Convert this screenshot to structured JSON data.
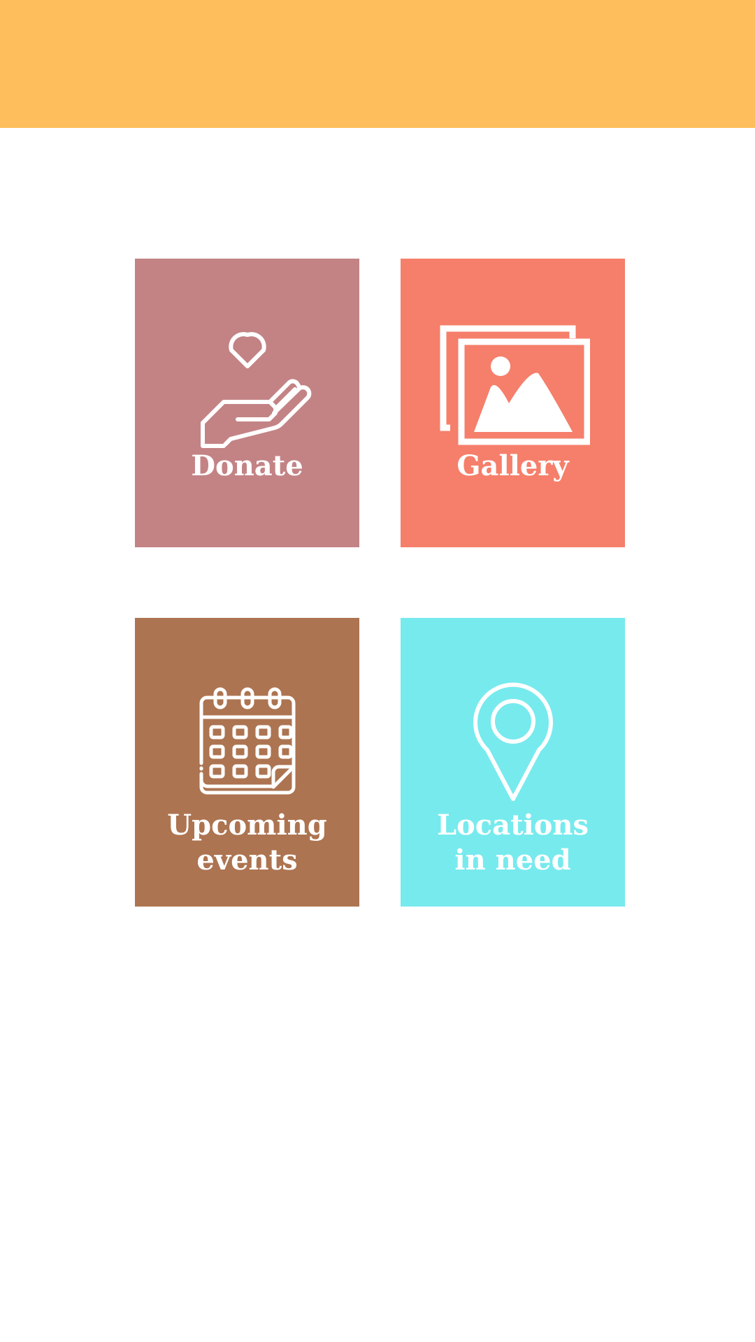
{
  "header": {
    "color": "#ffbe5c"
  },
  "tiles": [
    {
      "label_lines": [
        "Donate"
      ],
      "icon": "hand-heart-icon",
      "color": "#c38385"
    },
    {
      "label_lines": [
        "Gallery"
      ],
      "icon": "gallery-icon",
      "color": "#f57f6b"
    },
    {
      "label_lines": [
        "Upcoming",
        "events"
      ],
      "icon": "calendar-icon",
      "color": "#ad7451"
    },
    {
      "label_lines": [
        "Locations",
        "in need"
      ],
      "icon": "location-pin-icon",
      "color": "#77eaee"
    }
  ]
}
